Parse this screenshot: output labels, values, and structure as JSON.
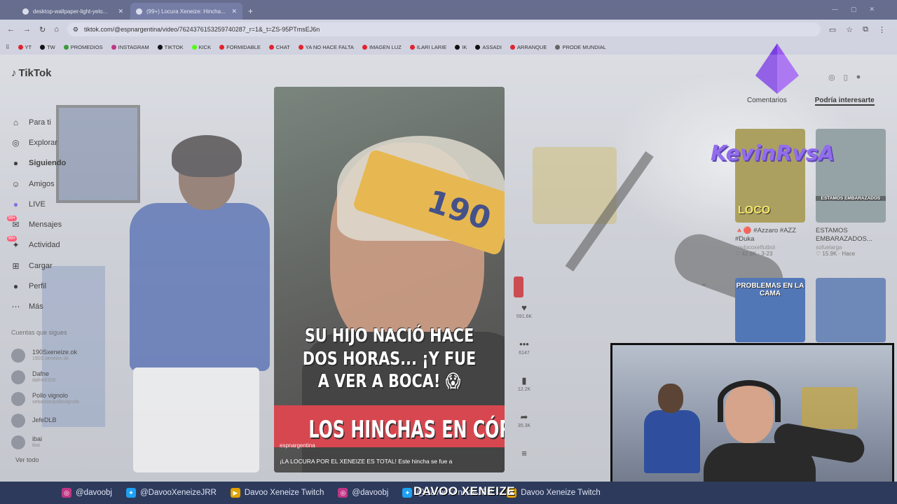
{
  "browser": {
    "tabs": [
      {
        "label": "desktop-wallpaper-light-yelo...",
        "active": false
      },
      {
        "label": "(99+) Locura Xeneize: Hincha...",
        "active": true
      }
    ],
    "new_tab": "+",
    "url": "tiktok.com/@espnargentina/video/7624376153259740287_r=1&_t=ZS-95PTmsEJ6n",
    "bookmarks": [
      "YT",
      "TW",
      "PROMEDIOS",
      "INSTAGRAM",
      "TIKTOK",
      "KICK",
      "FORMIDABLE",
      "CHAT",
      "YA NO HACE FALTA",
      "IMAGEN LUZ",
      "ILARI LARIE",
      "IK",
      "ASSADI",
      "ARRANQUE",
      "PRODE MUNDIAL"
    ],
    "bookmark_colors": [
      "#e0242f",
      "#111111",
      "#3c9a3c",
      "#c13584",
      "#111111",
      "#53fc18",
      "#e0242f",
      "#e0242f",
      "#e0242f",
      "#e0242f",
      "#e0242f",
      "#111111",
      "#111111",
      "#e0242f",
      "#666666"
    ]
  },
  "tiktok": {
    "logo": "TikTok",
    "nav": [
      {
        "label": "Para ti",
        "icon": "home-icon",
        "bold": false
      },
      {
        "label": "Explorar",
        "icon": "compass-icon",
        "bold": false
      },
      {
        "label": "Siguiendo",
        "icon": "following-avatar-icon",
        "bold": true
      },
      {
        "label": "Amigos",
        "icon": "friends-icon",
        "bold": false
      },
      {
        "label": "LIVE",
        "icon": "live-icon",
        "bold": false
      },
      {
        "label": "Mensajes",
        "icon": "messages-icon",
        "bold": false,
        "badge": "99+"
      },
      {
        "label": "Actividad",
        "icon": "activity-icon",
        "bold": false,
        "badge": "99+"
      },
      {
        "label": "Cargar",
        "icon": "upload-icon",
        "bold": false
      },
      {
        "label": "Perfil",
        "icon": "profile-avatar-icon",
        "bold": false
      },
      {
        "label": "Más",
        "icon": "more-icon",
        "bold": false
      }
    ],
    "following_title": "Cuentas que sigues",
    "following": [
      {
        "name": "190Sxeneize.ok",
        "handle": "190S.xeneize.ok"
      },
      {
        "name": "Dafne",
        "handle": "dafne0328"
      },
      {
        "name": "Pollo vignolo",
        "handle": "sebastianpollovignolo"
      },
      {
        "name": "JefeDLB",
        "handle": ""
      },
      {
        "name": "ibai",
        "handle": "ibai"
      }
    ],
    "see_all": "Ver todo"
  },
  "video": {
    "hat_number": "190",
    "caption_lines": [
      "SU HIJO NACIÓ HACE",
      "DOS HORAS... ¡Y FUE",
      "A VER A BOCA! 😱"
    ],
    "banner": "LOS HINCHAS EN CÓRDOBA",
    "author": "espnargentina",
    "description": "¡LA LOCURA POR EL XENEIZE ES TOTAL! Este hincha se fue a",
    "actions": [
      {
        "icon": "heart-icon",
        "glyph": "♥",
        "count": "591.6K"
      },
      {
        "icon": "comment-icon",
        "glyph": "•••",
        "count": "6147"
      },
      {
        "icon": "bookmark-icon",
        "glyph": "▮",
        "count": "12.2K"
      },
      {
        "icon": "share-icon",
        "glyph": "➦",
        "count": "35.3K"
      }
    ]
  },
  "right": {
    "tabs": [
      "Comentarios",
      "Podría interesarte"
    ],
    "active_tab": "Podría interesarte",
    "overlay_name": "KevinRvsA",
    "cards": [
      {
        "thumb_text": "LOCO",
        "title": "🔺🔴 #Azzaro #AZZ #Duka",
        "author": "soylocoxelfutbol",
        "stats": "♡ 42.9K · 3-23",
        "thumb_color": "#9a8b3e"
      },
      {
        "thumb_text": "ESTAMOS EMBARAZADOS",
        "title": "ESTAMOS EMBARAZADOS...",
        "author": "sofuelarga",
        "stats": "♡ 15.9K · Hace",
        "thumb_color": "#7f8f93"
      },
      {
        "thumb_text": "PROBLEMAS EN LA CAMA",
        "title": "",
        "author": "",
        "stats": "",
        "thumb_color": "#2c5aa8"
      },
      {
        "thumb_text": "",
        "title": "",
        "author": "",
        "stats": "",
        "thumb_color": "#4f6ea9"
      }
    ]
  },
  "footer": {
    "items": [
      {
        "icon": "instagram-icon",
        "text": "@davoobj",
        "color": "#c13584"
      },
      {
        "icon": "twitter-icon",
        "text": "@DavooXeneizeJRR",
        "color": "#1da1f2"
      },
      {
        "icon": "youtube-icon",
        "text": "Davoo Xeneize Twitch",
        "color": "#e0a100"
      },
      {
        "icon": "instagram-icon",
        "text": "@davoobj",
        "color": "#c13584"
      },
      {
        "icon": "twitter-icon",
        "text": "@DavooXeneizeJRR",
        "color": "#1da1f2"
      },
      {
        "icon": "youtube-icon",
        "text": "Davoo Xeneize Twitch",
        "color": "#e0a100"
      }
    ],
    "center_title": "DAVOO XENEIZE"
  }
}
